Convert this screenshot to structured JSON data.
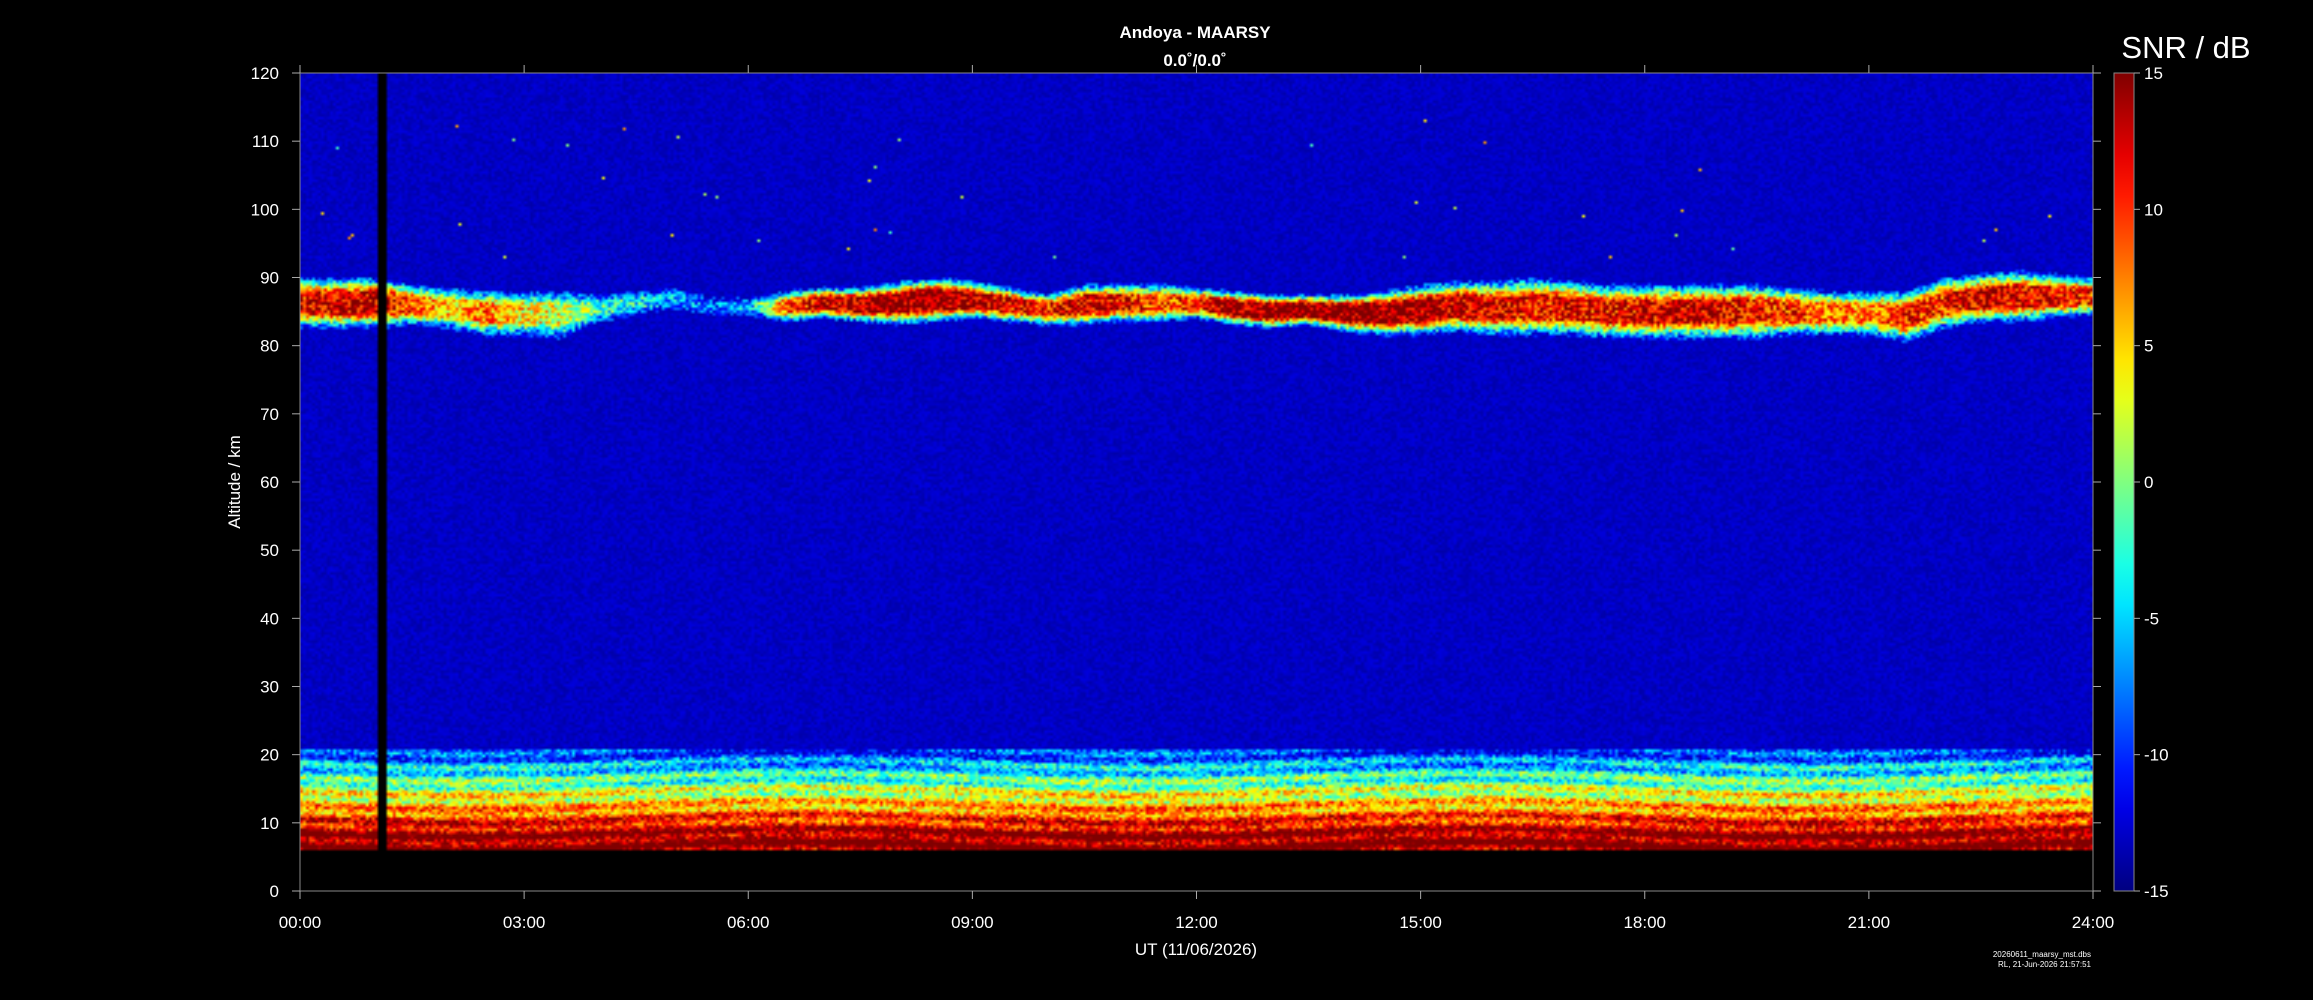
{
  "chart_data": {
    "type": "heatmap",
    "title": "Andoya - MAARSY",
    "subtitle": "0.0˚/0.0˚",
    "xlabel": "UT (11/06/2026)",
    "ylabel": "Altitude / km",
    "xlim": [
      0,
      24
    ],
    "ylim": [
      0,
      120
    ],
    "x_ticks": [
      "00:00",
      "03:00",
      "06:00",
      "09:00",
      "12:00",
      "15:00",
      "18:00",
      "21:00",
      "24:00"
    ],
    "y_ticks": [
      "0",
      "10",
      "20",
      "30",
      "40",
      "50",
      "60",
      "70",
      "80",
      "90",
      "100",
      "110",
      "120"
    ],
    "colorbar": {
      "label": "SNR / dB",
      "range": [
        -15,
        15
      ],
      "ticks": [
        "-15",
        "-10",
        "-5",
        "0",
        "5",
        "10",
        "15"
      ],
      "colormap": "jet"
    },
    "background_value_db": -13,
    "data_gap": {
      "time_ut_h": 1.1,
      "alt_range_km": [
        6,
        120
      ]
    },
    "layers": [
      {
        "name": "mesospheric echoes (PMSE)",
        "alt_range_km": [
          80,
          91
        ],
        "max_snr_db": 15
      },
      {
        "name": "tropospheric echoes",
        "alt_range_km": [
          6,
          21
        ],
        "max_snr_db": 15
      }
    ],
    "no_data_below_km": 6,
    "pmse_profile": [
      {
        "t": 0.0,
        "top": 89.5,
        "bot": 83.0,
        "snr": 11
      },
      {
        "t": 0.5,
        "top": 89.5,
        "bot": 83.0,
        "snr": 13
      },
      {
        "t": 1.0,
        "top": 89.5,
        "bot": 83.0,
        "snr": 13
      },
      {
        "t": 1.5,
        "top": 88.5,
        "bot": 83.5,
        "snr": 9
      },
      {
        "t": 2.0,
        "top": 88.0,
        "bot": 83.0,
        "snr": 5
      },
      {
        "t": 2.5,
        "top": 87.5,
        "bot": 82.0,
        "snr": 8
      },
      {
        "t": 3.0,
        "top": 87.5,
        "bot": 82.0,
        "snr": 4
      },
      {
        "t": 3.5,
        "top": 87.5,
        "bot": 81.5,
        "snr": 3
      },
      {
        "t": 4.0,
        "top": 87.0,
        "bot": 84.0,
        "snr": -2
      },
      {
        "t": 4.5,
        "top": 87.5,
        "bot": 85.0,
        "snr": -4
      },
      {
        "t": 5.0,
        "top": 88.0,
        "bot": 86.0,
        "snr": -6
      },
      {
        "t": 5.5,
        "top": 86.5,
        "bot": 85.0,
        "snr": -8
      },
      {
        "t": 6.0,
        "top": 86.5,
        "bot": 85.0,
        "snr": -6
      },
      {
        "t": 6.5,
        "top": 87.5,
        "bot": 84.0,
        "snr": 8
      },
      {
        "t": 7.0,
        "top": 88.0,
        "bot": 84.5,
        "snr": 13
      },
      {
        "t": 7.5,
        "top": 88.0,
        "bot": 84.0,
        "snr": 14
      },
      {
        "t": 8.0,
        "top": 89.0,
        "bot": 83.5,
        "snr": 14
      },
      {
        "t": 8.5,
        "top": 89.5,
        "bot": 84.0,
        "snr": 15
      },
      {
        "t": 9.0,
        "top": 89.0,
        "bot": 84.5,
        "snr": 14
      },
      {
        "t": 9.5,
        "top": 88.0,
        "bot": 84.0,
        "snr": 12
      },
      {
        "t": 10.0,
        "top": 87.0,
        "bot": 83.5,
        "snr": 10
      },
      {
        "t": 10.5,
        "top": 88.5,
        "bot": 83.5,
        "snr": 13
      },
      {
        "t": 11.0,
        "top": 88.5,
        "bot": 84.0,
        "snr": 12
      },
      {
        "t": 11.5,
        "top": 88.5,
        "bot": 84.0,
        "snr": 9
      },
      {
        "t": 12.0,
        "top": 88.0,
        "bot": 84.5,
        "snr": 10
      },
      {
        "t": 12.5,
        "top": 87.5,
        "bot": 83.5,
        "snr": 14
      },
      {
        "t": 13.0,
        "top": 87.0,
        "bot": 83.0,
        "snr": 15
      },
      {
        "t": 13.5,
        "top": 87.0,
        "bot": 83.5,
        "snr": 15
      },
      {
        "t": 14.0,
        "top": 87.0,
        "bot": 82.5,
        "snr": 15
      },
      {
        "t": 14.5,
        "top": 87.5,
        "bot": 82.0,
        "snr": 15
      },
      {
        "t": 15.0,
        "top": 88.5,
        "bot": 82.0,
        "snr": 14
      },
      {
        "t": 15.5,
        "top": 89.0,
        "bot": 82.5,
        "snr": 13
      },
      {
        "t": 16.0,
        "top": 89.0,
        "bot": 82.0,
        "snr": 12
      },
      {
        "t": 16.5,
        "top": 89.5,
        "bot": 82.0,
        "snr": 11
      },
      {
        "t": 17.0,
        "top": 89.0,
        "bot": 82.0,
        "snr": 12
      },
      {
        "t": 17.5,
        "top": 88.5,
        "bot": 81.5,
        "snr": 11
      },
      {
        "t": 18.0,
        "top": 88.5,
        "bot": 81.5,
        "snr": 12
      },
      {
        "t": 18.5,
        "top": 88.5,
        "bot": 81.5,
        "snr": 13
      },
      {
        "t": 19.0,
        "top": 88.5,
        "bot": 81.5,
        "snr": 12
      },
      {
        "t": 19.5,
        "top": 88.5,
        "bot": 81.5,
        "snr": 11
      },
      {
        "t": 20.0,
        "top": 88.0,
        "bot": 82.0,
        "snr": 10
      },
      {
        "t": 20.5,
        "top": 87.5,
        "bot": 82.0,
        "snr": 8
      },
      {
        "t": 21.0,
        "top": 87.5,
        "bot": 82.0,
        "snr": 7
      },
      {
        "t": 21.5,
        "top": 87.5,
        "bot": 81.0,
        "snr": 11
      },
      {
        "t": 22.0,
        "top": 89.5,
        "bot": 83.0,
        "snr": 10
      },
      {
        "t": 22.5,
        "top": 90.0,
        "bot": 84.0,
        "snr": 13
      },
      {
        "t": 23.0,
        "top": 90.5,
        "bot": 84.0,
        "snr": 12
      },
      {
        "t": 23.5,
        "top": 90.0,
        "bot": 84.5,
        "snr": 11
      },
      {
        "t": 24.0,
        "top": 89.5,
        "bot": 85.0,
        "snr": 10
      }
    ]
  },
  "footer": {
    "file_name": "20260611_maarsy_mst.dbs",
    "stamp": "RL, 21-Jun-2026 21:57:51"
  }
}
